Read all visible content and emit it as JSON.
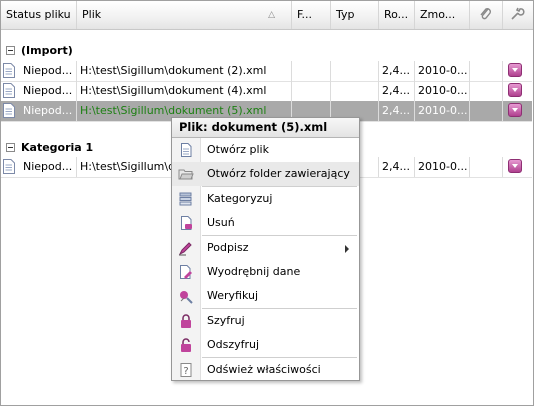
{
  "header": {
    "col_status": "Status pliku",
    "col_plik": "Plik",
    "col_f": "F...",
    "col_typ": "Typ",
    "col_ro": "Ro...",
    "col_zmo": "Zmo...",
    "sort_glyph": "△",
    "attach_icon": "paperclip-icon",
    "tools_icon": "wrench-icon"
  },
  "groups": [
    {
      "name": "(Import)",
      "rows": [
        {
          "status": "Niepod...",
          "plik": "H:\\test\\Sigillum\\dokument (2).xml",
          "ro": "2,4...",
          "zmo": "2010-0..."
        },
        {
          "status": "Niepod...",
          "plik": "H:\\test\\Sigillum\\dokument (4).xml",
          "ro": "2,4...",
          "zmo": "2010-0..."
        },
        {
          "status": "Niepod...",
          "plik": "H:\\test\\Sigillum\\dokument (5).xml",
          "ro": "2,4...",
          "zmo": "2010-0..."
        }
      ]
    },
    {
      "name": "Kategoria 1",
      "rows": [
        {
          "status": "Niepod...",
          "plik": "H:\\test\\Sigillum\\dok",
          "ro": "2,4...",
          "zmo": "2010-0..."
        }
      ]
    }
  ],
  "context_menu": {
    "title": "Plik: dokument (5).xml",
    "items": [
      {
        "label": "Otwórz plik",
        "icon": "document-icon"
      },
      {
        "label": "Otwórz folder zawierający",
        "icon": "folder-open-icon"
      },
      {
        "label": "Kategoryzuj",
        "icon": "categorize-icon"
      },
      {
        "label": "Usuń",
        "icon": "delete-icon"
      },
      {
        "label": "Podpisz",
        "icon": "sign-pen-icon"
      },
      {
        "label": "Wyodrębnij dane",
        "icon": "extract-data-icon"
      },
      {
        "label": "Weryfikuj",
        "icon": "verify-icon"
      },
      {
        "label": "Szyfruj",
        "icon": "lock-icon"
      },
      {
        "label": "Odszyfruj",
        "icon": "unlock-icon"
      },
      {
        "label": "Odśwież właściwości",
        "icon": "refresh-properties-icon"
      }
    ]
  },
  "colors": {
    "selected_row_bg": "#a9a9a9",
    "selected_row_text": "#1c7f12",
    "row_button": "#b0408f"
  }
}
